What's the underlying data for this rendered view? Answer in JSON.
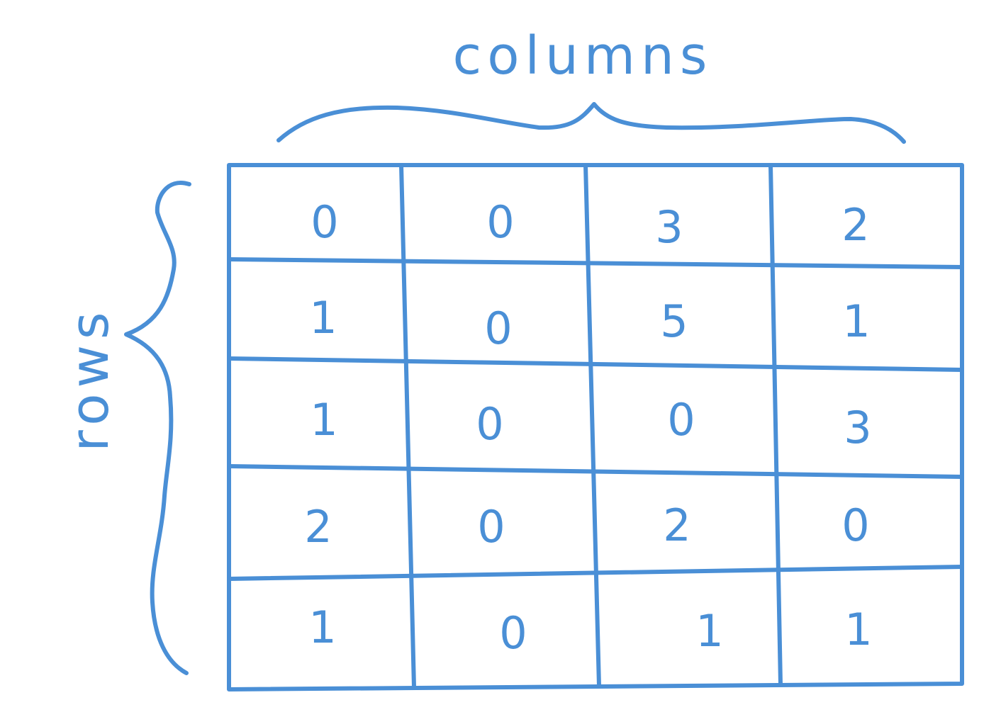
{
  "labels": {
    "columns": "columns",
    "rows": "rows"
  },
  "grid": [
    [
      "0",
      "0",
      "3",
      "2"
    ],
    [
      "1",
      "0",
      "5",
      "1"
    ],
    [
      "1",
      "0",
      "0",
      "3"
    ],
    [
      "2",
      "0",
      "2",
      "0"
    ],
    [
      "1",
      "0",
      "1",
      "1"
    ]
  ],
  "colors": {
    "ink": "#4a8fd6",
    "background": "#ffffff"
  }
}
